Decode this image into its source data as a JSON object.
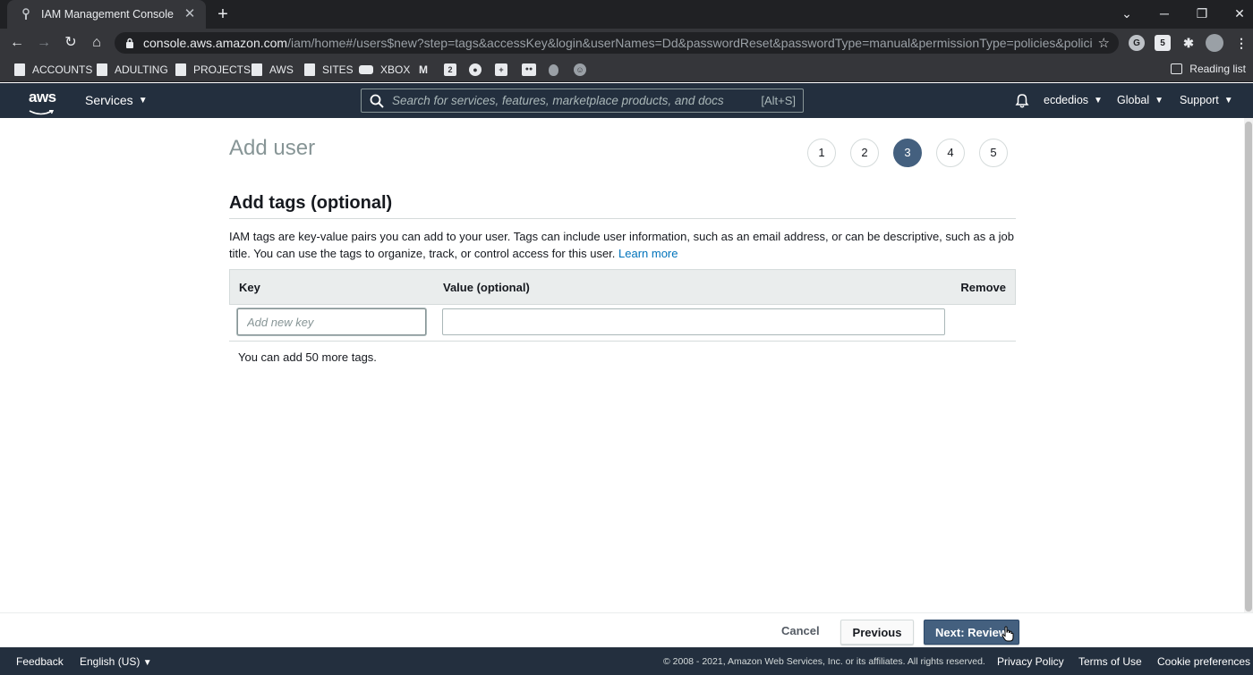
{
  "browser": {
    "tab_title": "IAM Management Console",
    "tab_close": "✕",
    "new_tab": "+",
    "window_controls": {
      "minimize": "─",
      "maximize": "❐",
      "close": "✕",
      "tab_search": "⌄"
    },
    "nav": {
      "back": "←",
      "forward": "→",
      "reload": "↻",
      "home": "⌂"
    },
    "url_host": "console.aws.amazon.com",
    "url_path": "/iam/home#/users$new?step=tags&accessKey&login&userNames=Dd&passwordReset&passwordType=manual&permissionType=policies&policies=arn:aws:ia...",
    "bookmark_star": "☆",
    "extension_badge": "5",
    "bookmarks": [
      "ACCOUNTS",
      "ADULTING",
      "PROJECTS",
      "AWS",
      "SITES",
      "XBOX"
    ],
    "bookmark_icons": [
      "gmail-icon",
      "b-icon",
      "github-icon",
      "plus-icon",
      "medium-icon",
      "apple-icon",
      "reddit-icon"
    ],
    "bookmark_icon_glyphs": [
      "M",
      "2",
      "●",
      "+",
      "●●",
      "",
      "☺"
    ],
    "reading_list": "Reading list"
  },
  "aws_header": {
    "logo_text": "aws",
    "services_label": "Services",
    "caret": "▼",
    "search_placeholder": "Search for services, features, marketplace products, and docs",
    "search_shortcut": "[Alt+S]",
    "account": "ecdedios",
    "region": "Global",
    "support": "Support",
    "colors": {
      "bg": "#232f3e",
      "accent": "#ff9900"
    }
  },
  "wizard": {
    "page_title": "Add user",
    "steps": [
      "1",
      "2",
      "3",
      "4",
      "5"
    ],
    "current_step": "3",
    "section_title": "Add tags (optional)",
    "description": "IAM tags are key-value pairs you can add to your user. Tags can include user information, such as an email address, or can be descriptive, such as a job title. You can use the tags to organize, track, or control access for this user. ",
    "learn_more": "Learn more",
    "table": {
      "columns": [
        "Key",
        "Value (optional)",
        "Remove"
      ],
      "key_placeholder": "Add new key",
      "value": ""
    },
    "remaining_tags": "You can add 50 more tags.",
    "active_color": "#44607f"
  },
  "actions": {
    "cancel": "Cancel",
    "previous": "Previous",
    "next": "Next: Review"
  },
  "footer": {
    "feedback": "Feedback",
    "language": "English (US)",
    "caret": "▼",
    "copyright": "© 2008 - 2021, Amazon Web Services, Inc. or its affiliates. All rights reserved.",
    "privacy": "Privacy Policy",
    "terms": "Terms of Use",
    "cookies": "Cookie preferences"
  }
}
